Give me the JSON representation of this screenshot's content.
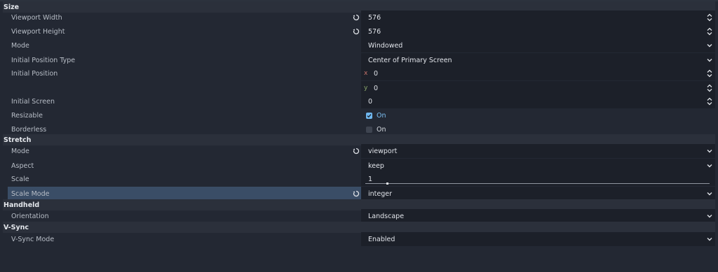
{
  "sections": {
    "size": "Size",
    "stretch": "Stretch",
    "handheld": "Handheld",
    "vsync": "V-Sync"
  },
  "size": {
    "viewport_width": {
      "label": "Viewport Width",
      "value": "576"
    },
    "viewport_height": {
      "label": "Viewport Height",
      "value": "576"
    },
    "mode": {
      "label": "Mode",
      "value": "Windowed"
    },
    "initial_position_type": {
      "label": "Initial Position Type",
      "value": "Center of Primary Screen"
    },
    "initial_position": {
      "label": "Initial Position",
      "x_label": "x",
      "x": "0",
      "y_label": "y",
      "y": "0"
    },
    "initial_screen": {
      "label": "Initial Screen",
      "value": "0"
    },
    "resizable": {
      "label": "Resizable",
      "value": "On",
      "checked": true
    },
    "borderless": {
      "label": "Borderless",
      "value": "On",
      "checked": false
    }
  },
  "stretch": {
    "mode": {
      "label": "Mode",
      "value": "viewport"
    },
    "aspect": {
      "label": "Aspect",
      "value": "keep"
    },
    "scale": {
      "label": "Scale",
      "value": "1"
    },
    "scale_mode": {
      "label": "Scale Mode",
      "value": "integer"
    }
  },
  "handheld": {
    "orientation": {
      "label": "Orientation",
      "value": "Landscape"
    }
  },
  "vsync": {
    "mode": {
      "label": "V-Sync Mode",
      "value": "Enabled"
    }
  },
  "icons": {
    "revert": "revert-icon",
    "dropdown": "chevron-down-icon",
    "spin": "spin-arrows-icon",
    "checkbox": "checkbox-icon"
  },
  "colors": {
    "background": "#232833",
    "section_header": "#2b303b",
    "value_field": "#1c2029",
    "selected_row": "#3a4d66",
    "accent": "#6fb7ef",
    "axis_x": "#c9736b",
    "axis_y": "#8ba86c"
  }
}
